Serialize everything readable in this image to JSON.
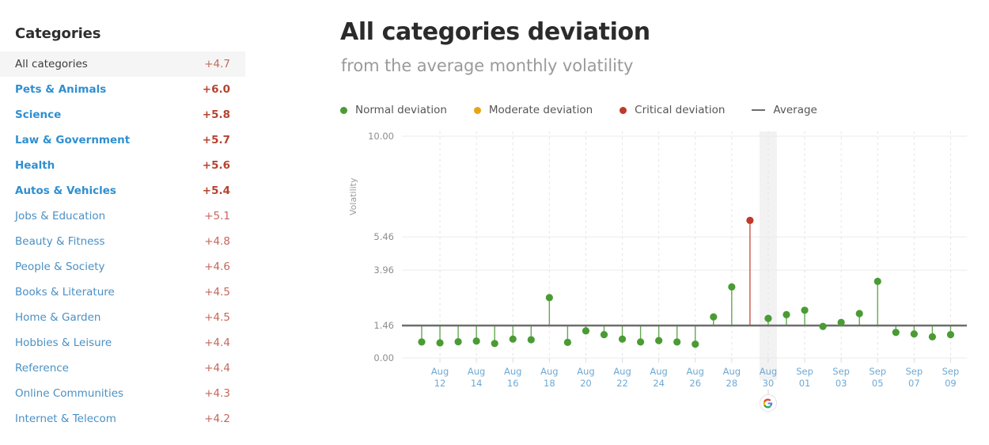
{
  "sidebar": {
    "title": "Categories",
    "items": [
      {
        "label": "All categories",
        "value": "+4.7",
        "selected": true,
        "bold": false
      },
      {
        "label": "Pets & Animals",
        "value": "+6.0",
        "selected": false,
        "bold": true
      },
      {
        "label": "Science",
        "value": "+5.8",
        "selected": false,
        "bold": true
      },
      {
        "label": "Law & Government",
        "value": "+5.7",
        "selected": false,
        "bold": true
      },
      {
        "label": "Health",
        "value": "+5.6",
        "selected": false,
        "bold": true
      },
      {
        "label": "Autos & Vehicles",
        "value": "+5.4",
        "selected": false,
        "bold": true
      },
      {
        "label": "Jobs & Education",
        "value": "+5.1",
        "selected": false,
        "bold": false
      },
      {
        "label": "Beauty & Fitness",
        "value": "+4.8",
        "selected": false,
        "bold": false
      },
      {
        "label": "People & Society",
        "value": "+4.6",
        "selected": false,
        "bold": false
      },
      {
        "label": "Books & Literature",
        "value": "+4.5",
        "selected": false,
        "bold": false
      },
      {
        "label": "Home & Garden",
        "value": "+4.5",
        "selected": false,
        "bold": false
      },
      {
        "label": "Hobbies & Leisure",
        "value": "+4.4",
        "selected": false,
        "bold": false
      },
      {
        "label": "Reference",
        "value": "+4.4",
        "selected": false,
        "bold": false
      },
      {
        "label": "Online Communities",
        "value": "+4.3",
        "selected": false,
        "bold": false
      },
      {
        "label": "Internet & Telecom",
        "value": "+4.2",
        "selected": false,
        "bold": false
      }
    ]
  },
  "header": {
    "title": "All categories deviation",
    "subtitle": "from the average monthly volatility"
  },
  "legend": [
    {
      "label": "Normal deviation",
      "marker": "dot",
      "color": "#4a9b34"
    },
    {
      "label": "Moderate deviation",
      "marker": "dot",
      "color": "#e8a317"
    },
    {
      "label": "Critical deviation",
      "marker": "dot",
      "color": "#c0392b"
    },
    {
      "label": "Average",
      "marker": "line",
      "color": "#6e6e6e"
    }
  ],
  "colors": {
    "normal": "#4a9b34",
    "moderate": "#e8a317",
    "critical": "#c0392b",
    "average_line": "#6e6e6e",
    "grid": "#ebebeb",
    "gridline_dashed": "#e4e4e4",
    "highlight_band": "#f0f0f0",
    "axis_text": "#8d8d8d",
    "date_text": "#6ea9d4",
    "category_link": "#4a90c4",
    "category_value": "#c4675a"
  },
  "chart_data": {
    "type": "scatter",
    "title": "All categories deviation",
    "subtitle": "from the average monthly volatility",
    "xlabel": "",
    "ylabel": "Volatility",
    "ylim": [
      0.0,
      10.0
    ],
    "yticks": [
      0.0,
      1.46,
      3.96,
      5.46,
      10.0
    ],
    "ytick_labels": [
      "0.00",
      "1.46",
      "3.96",
      "5.46",
      "10.00"
    ],
    "average": 1.46,
    "average_label": "Average",
    "grid": true,
    "legend_position": "top-left",
    "highlight_x": "Aug 30",
    "highlight_logo": "google-g-icon",
    "xtick_labels": [
      "Aug 12",
      "Aug 14",
      "Aug 16",
      "Aug 18",
      "Aug 20",
      "Aug 22",
      "Aug 24",
      "Aug 26",
      "Aug 28",
      "Aug 30",
      "Sep 01",
      "Sep 03",
      "Sep 05",
      "Sep 07",
      "Sep 09"
    ],
    "x": [
      "Aug 11",
      "Aug 12",
      "Aug 13",
      "Aug 14",
      "Aug 15",
      "Aug 16",
      "Aug 17",
      "Aug 18",
      "Aug 19",
      "Aug 20",
      "Aug 21",
      "Aug 22",
      "Aug 23",
      "Aug 24",
      "Aug 25",
      "Aug 26",
      "Aug 27",
      "Aug 28",
      "Aug 29",
      "Aug 30",
      "Aug 31",
      "Sep 01",
      "Sep 02",
      "Sep 03",
      "Sep 04",
      "Sep 05",
      "Sep 06",
      "Sep 07",
      "Sep 08",
      "Sep 09"
    ],
    "values": [
      0.72,
      0.68,
      0.73,
      0.76,
      0.65,
      0.85,
      0.82,
      2.72,
      0.7,
      1.22,
      1.05,
      0.85,
      0.72,
      0.78,
      0.72,
      0.62,
      1.85,
      3.2,
      6.2,
      1.78,
      1.95,
      2.15,
      1.42,
      1.6,
      2.0,
      3.45,
      1.15,
      1.08,
      0.95,
      1.05
    ],
    "point_status": [
      "normal",
      "normal",
      "normal",
      "normal",
      "normal",
      "normal",
      "normal",
      "normal",
      "normal",
      "normal",
      "normal",
      "normal",
      "normal",
      "normal",
      "normal",
      "normal",
      "normal",
      "normal",
      "critical",
      "normal",
      "normal",
      "normal",
      "normal",
      "normal",
      "normal",
      "normal",
      "normal",
      "normal",
      "normal",
      "normal"
    ]
  }
}
